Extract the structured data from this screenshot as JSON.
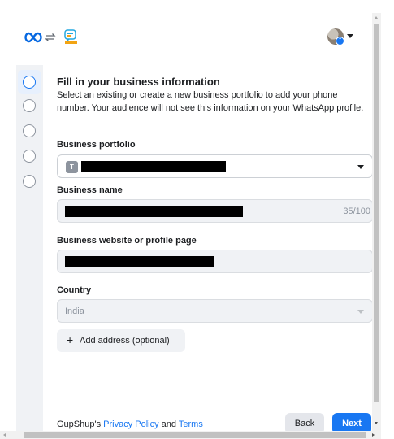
{
  "header": {
    "meta_logo_icon": "meta-infinity-logo",
    "swap_icon": "swap-arrows-icon",
    "partner_logo_icon": "gupshup-logo",
    "avatar_badge": "f"
  },
  "steps": [
    {
      "state": "active"
    },
    {
      "state": "pending"
    },
    {
      "state": "pending"
    },
    {
      "state": "pending"
    },
    {
      "state": "pending"
    }
  ],
  "form": {
    "title": "Fill in your business information",
    "description": "Select an existing or create a new business portfolio to add your phone number. Your audience will not see this information on your WhatsApp profile.",
    "business_portfolio": {
      "label": "Business portfolio",
      "badge": "T",
      "value": "[redacted]"
    },
    "business_name": {
      "label": "Business name",
      "value": "[redacted]",
      "counter": "35/100"
    },
    "website": {
      "label": "Business website or profile page",
      "value": "[redacted]"
    },
    "country": {
      "label": "Country",
      "value": "India"
    },
    "add_address_label": "Add address (optional)"
  },
  "footer": {
    "prefix": "GupShup's ",
    "privacy_link": "Privacy Policy",
    "and": " and ",
    "terms_link": "Terms",
    "back_label": "Back",
    "next_label": "Next"
  },
  "colors": {
    "accent": "#1877f2",
    "field_bg": "#f0f2f5",
    "border": "#ccd0d5"
  }
}
